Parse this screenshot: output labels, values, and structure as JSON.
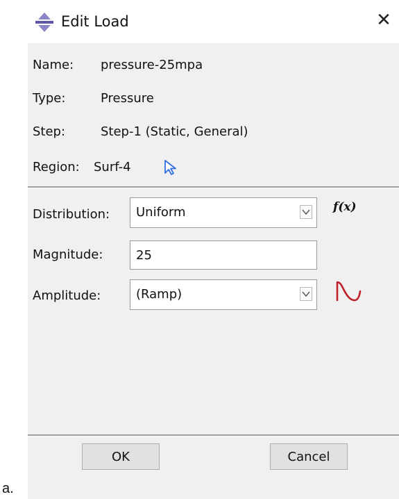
{
  "dialog": {
    "title": "Edit Load",
    "close_glyph": "✕"
  },
  "info": {
    "name_label": "Name:",
    "name_value": "pressure-25mpa",
    "type_label": "Type:",
    "type_value": "Pressure",
    "step_label": "Step:",
    "step_value": "Step-1 (Static, General)",
    "region_label": "Region:",
    "region_value": "Surf-4"
  },
  "fields": {
    "distribution_label": "Distribution:",
    "distribution_value": "Uniform",
    "fx_label": "f(x)",
    "magnitude_label": "Magnitude:",
    "magnitude_value": "25",
    "amplitude_label": "Amplitude:",
    "amplitude_value": "(Ramp)"
  },
  "buttons": {
    "ok_label": "OK",
    "cancel_label": "Cancel"
  },
  "caption": "a.",
  "icons": {
    "title": "load-arrows-icon",
    "region": "select-cursor-icon",
    "amplitude": "amplitude-curve-icon",
    "dropdown": "chevron-down-icon"
  },
  "colors": {
    "title_icon": "#8a86c4",
    "cursor_icon": "#2f6fe0",
    "amplitude_curve": "#c0202a",
    "dialog_bg": "#f0f0f0"
  }
}
